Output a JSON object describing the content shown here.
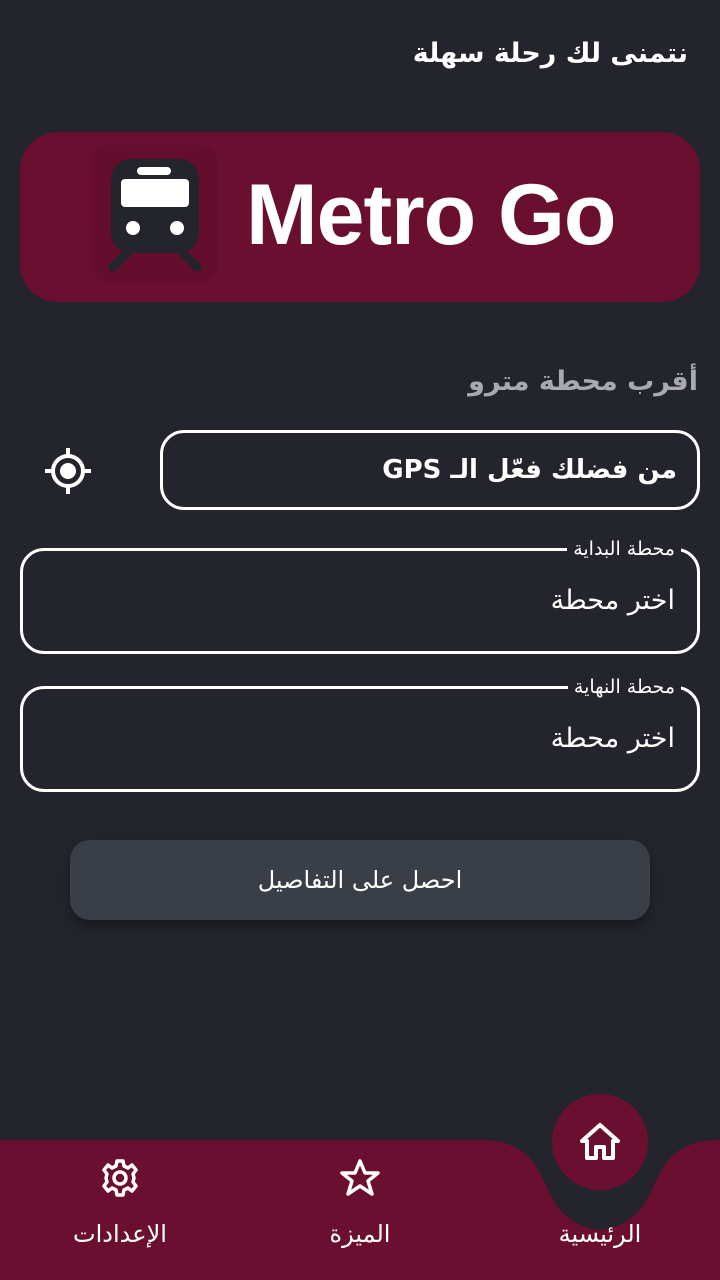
{
  "greeting": "نتمنى لك رحلة سهلة",
  "banner": {
    "brand": "Metro Go",
    "logo_icon": "train-icon"
  },
  "nearest_station": {
    "label": "أقرب محطة مترو",
    "gps_prompt": "من فضلك فعّل الـ GPS",
    "locate_icon": "gps-locate-icon"
  },
  "start_station": {
    "legend": "محطة البداية",
    "value": "اختر محطة"
  },
  "end_station": {
    "legend": "محطة النهاية",
    "value": "اختر محطة"
  },
  "cta": {
    "label": "احصل على التفاصيل"
  },
  "bottom_nav": {
    "home": {
      "label": "الرئيسية",
      "icon": "home-icon"
    },
    "favorite": {
      "label": "الميزة",
      "icon": "star-icon"
    },
    "settings": {
      "label": "الإعدادات",
      "icon": "gear-icon"
    }
  },
  "colors": {
    "background": "#24252c",
    "accent": "#6b0f30",
    "button": "#3a3e47",
    "muted_text": "#a9a9b0"
  }
}
